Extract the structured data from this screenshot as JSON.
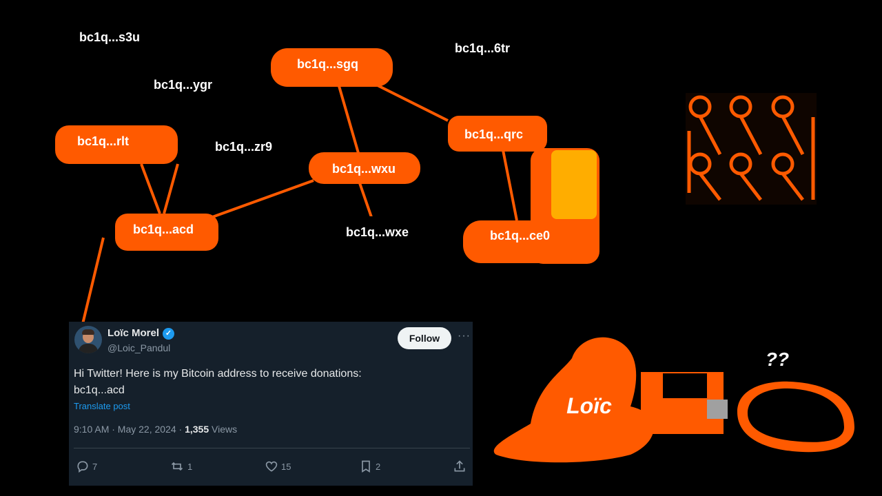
{
  "labels": {
    "s3u": "bc1q...s3u",
    "ygr": "bc1q...ygr",
    "zr9": "bc1q...zr9",
    "tr6": "bc1q...6tr"
  },
  "nodes": {
    "rlt": "bc1q...rlt",
    "sgq": "bc1q...sgq",
    "qrc": "bc1q...qrc",
    "wxu": "bc1q...wxu",
    "acd": "bc1q...acd",
    "wxe": "bc1q...wxe",
    "ce0": "bc1q...ce0"
  },
  "person": {
    "name": "Loïc",
    "thought": "??"
  },
  "tweet": {
    "author_name": "Loïc Morel",
    "author_handle": "@Loic_Pandul",
    "follow_label": "Follow",
    "text_line1": "Hi Twitter! Here is my Bitcoin address to receive donations:",
    "text_line2": "bc1q...acd",
    "translate": "Translate post",
    "time": "9:10 AM · May 22, 2024 · ",
    "views_count": "1,355",
    "views_label": " Views",
    "replies": "7",
    "reposts": "1",
    "likes": "15",
    "bookmarks": "2"
  },
  "colors": {
    "accent": "#ff5a00",
    "dark_node": "#000000",
    "tweet_bg": "#15202b"
  }
}
